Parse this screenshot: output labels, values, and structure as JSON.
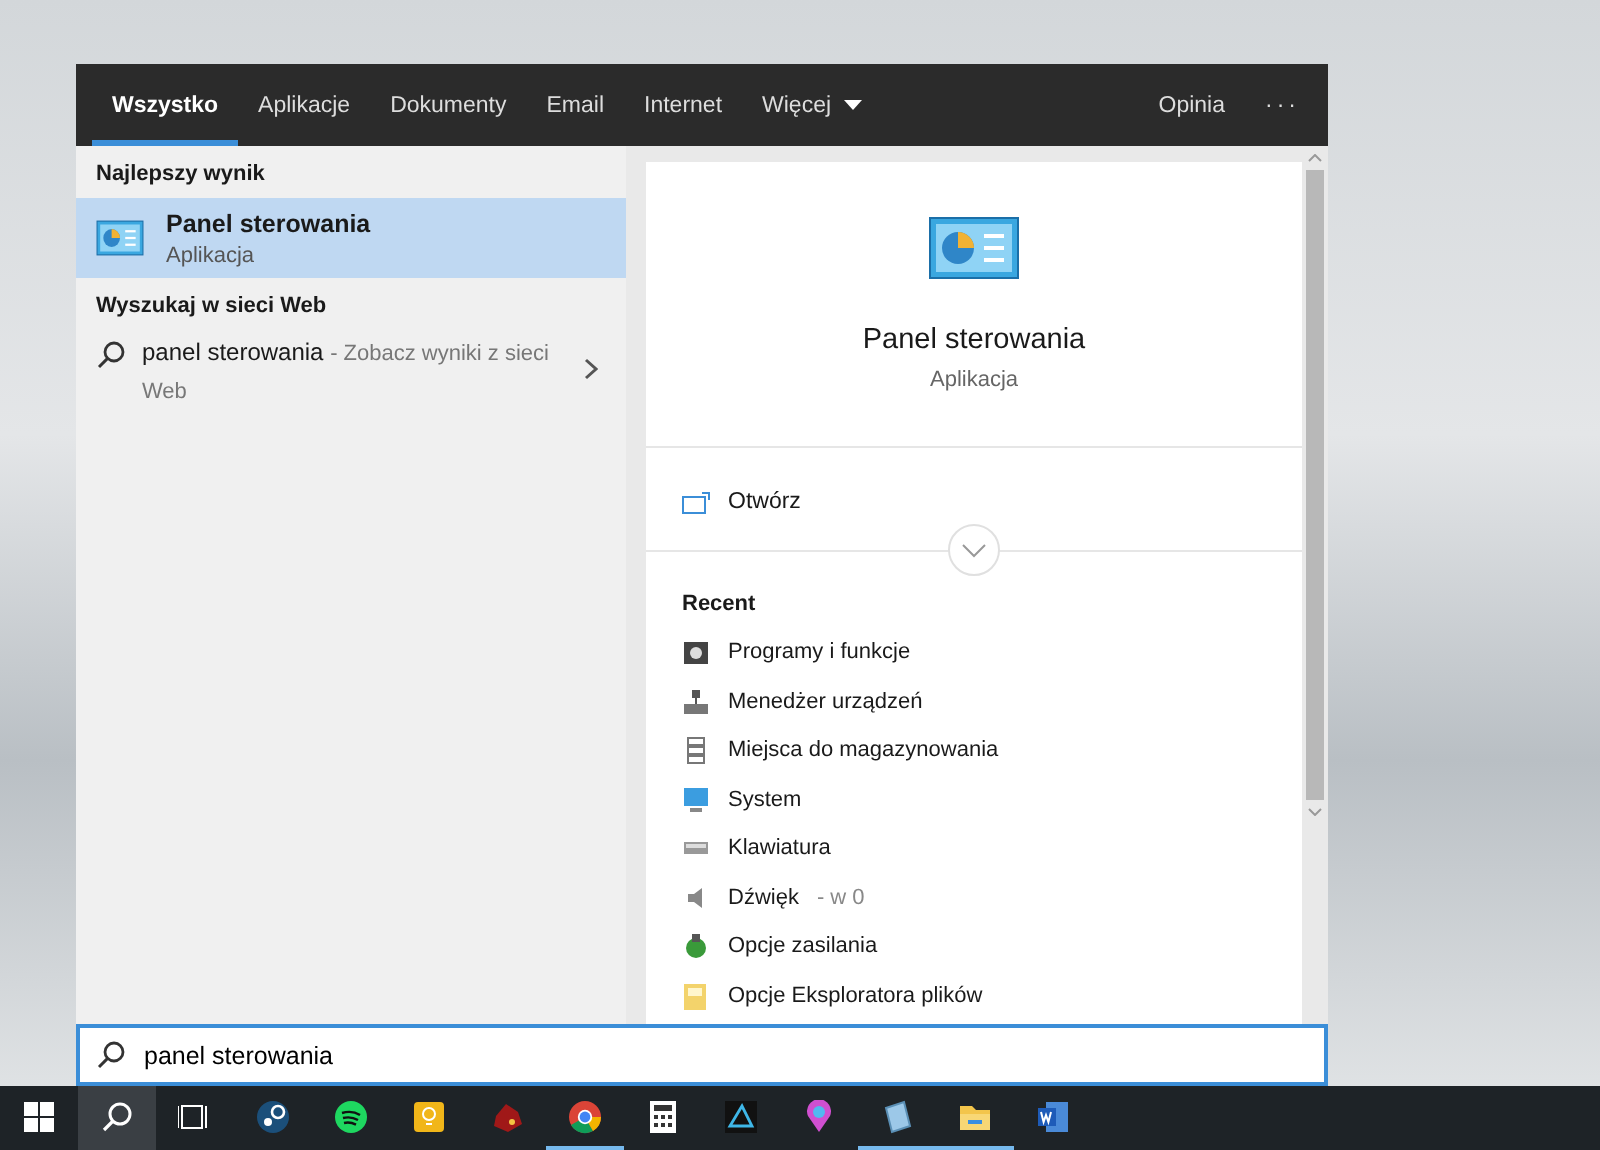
{
  "tabs": [
    {
      "label": "Wszystko",
      "selected": true
    },
    {
      "label": "Aplikacje",
      "selected": false
    },
    {
      "label": "Dokumenty",
      "selected": false
    },
    {
      "label": "Email",
      "selected": false
    },
    {
      "label": "Internet",
      "selected": false
    },
    {
      "label": "Więcej",
      "selected": false,
      "dropdown": true
    }
  ],
  "top_actions": {
    "feedback": "Opinia",
    "more": "···"
  },
  "best_match": {
    "heading": "Najlepszy wynik",
    "title": "Panel sterowania",
    "subtitle": "Aplikacja",
    "selected": true
  },
  "web_search": {
    "heading": "Wyszukaj w sieci Web",
    "query": "panel sterowania",
    "hint": "- Zobacz wyniki z sieci Web"
  },
  "preview": {
    "title": "Panel sterowania",
    "subtitle": "Aplikacja",
    "open_label": "Otwórz",
    "recent_heading": "Recent",
    "recent": [
      {
        "kind": "programs",
        "label": "Programy i funkcje"
      },
      {
        "kind": "devices",
        "label": "Menedżer urządzeń"
      },
      {
        "kind": "storage",
        "label": "Miejsca do magazynowania"
      },
      {
        "kind": "system",
        "label": "System"
      },
      {
        "kind": "keyboard",
        "label": "Klawiatura"
      },
      {
        "kind": "sound",
        "label": "Dźwięk",
        "detail": "- w 0"
      },
      {
        "kind": "power",
        "label": "Opcje zasilania"
      },
      {
        "kind": "folder-options",
        "label": "Opcje Eksploratora plików"
      }
    ]
  },
  "search_box": {
    "value": "panel sterowania"
  },
  "taskbar": [
    {
      "kind": "start",
      "active": false,
      "selected": false
    },
    {
      "kind": "search",
      "active": false,
      "selected": true
    },
    {
      "kind": "taskview",
      "active": false,
      "selected": false
    },
    {
      "kind": "steam",
      "active": false,
      "selected": false
    },
    {
      "kind": "spotify",
      "active": false,
      "selected": false
    },
    {
      "kind": "notes",
      "active": false,
      "selected": false
    },
    {
      "kind": "game",
      "active": false,
      "selected": false
    },
    {
      "kind": "chrome",
      "active": true,
      "selected": false
    },
    {
      "kind": "calculator",
      "active": false,
      "selected": false
    },
    {
      "kind": "tool",
      "active": false,
      "selected": false
    },
    {
      "kind": "paint",
      "active": false,
      "selected": false
    },
    {
      "kind": "notepad",
      "active": true,
      "selected": false
    },
    {
      "kind": "explorer",
      "active": true,
      "selected": false
    },
    {
      "kind": "word",
      "active": false,
      "selected": false
    }
  ]
}
